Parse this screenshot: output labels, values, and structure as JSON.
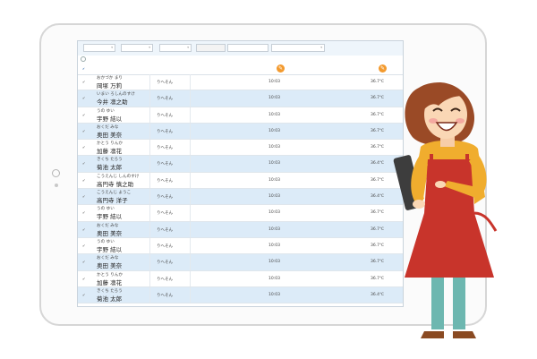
{
  "toolbar": {
    "select1": "",
    "select2": "",
    "select3": "",
    "button_label": "",
    "segment_label": "",
    "date_field": ""
  },
  "subbar": {
    "title": ""
  },
  "table": {
    "headers": {
      "name": "",
      "class": "",
      "time": "",
      "temp": ""
    },
    "rows": [
      {
        "kana": "おかづか まり",
        "kanji": "岡塚 万莉",
        "class": "りへそん",
        "time": "10:03",
        "temp": "36.7℃"
      },
      {
        "kana": "いまい ろしんのすけ",
        "kanji": "今井 凛之助",
        "class": "りへそん",
        "time": "10:03",
        "temp": "36.7℃"
      },
      {
        "kana": "うの ゆい",
        "kanji": "宇野 結以",
        "class": "りへそん",
        "time": "10:03",
        "temp": "36.7℃"
      },
      {
        "kana": "おくだ みな",
        "kanji": "奥田 美奈",
        "class": "りへそん",
        "time": "10:03",
        "temp": "36.7℃"
      },
      {
        "kana": "かとう りんか",
        "kanji": "加藤 凛花",
        "class": "りへそん",
        "time": "10:03",
        "temp": "36.7℃"
      },
      {
        "kana": "きくち たろう",
        "kanji": "菊池 太郎",
        "class": "りへそん",
        "time": "10:03",
        "temp": "36.4℃"
      },
      {
        "kana": "こうえんじ しんのすけ",
        "kanji": "高円寺 慎之助",
        "class": "りへそん",
        "time": "10:03",
        "temp": "36.7℃"
      },
      {
        "kana": "こうえんじ ようこ",
        "kanji": "高円寺 洋子",
        "class": "りへそん",
        "time": "10:03",
        "temp": "36.4℃"
      },
      {
        "kana": "うの ゆい",
        "kanji": "宇野 結以",
        "class": "りへそん",
        "time": "10:03",
        "temp": "36.7℃"
      },
      {
        "kana": "おくだ みな",
        "kanji": "奥田 美奈",
        "class": "りへそん",
        "time": "10:03",
        "temp": "36.7℃"
      },
      {
        "kana": "うの ゆい",
        "kanji": "宇野 結以",
        "class": "りへそん",
        "time": "10:03",
        "temp": "36.7℃"
      },
      {
        "kana": "おくだ みな",
        "kanji": "奥田 美奈",
        "class": "りへそん",
        "time": "10:03",
        "temp": "36.7℃"
      },
      {
        "kana": "かとう りんか",
        "kanji": "加藤 凛花",
        "class": "りへそん",
        "time": "10:03",
        "temp": "36.7℃"
      },
      {
        "kana": "きくち たろう",
        "kanji": "菊池 太郎",
        "class": "りへそん",
        "time": "10:03",
        "temp": "36.4℃"
      }
    ]
  },
  "colors": {
    "row_alt": "#dcebf8",
    "accent_orange": "#f39a2e",
    "header_blue": "#3a6fb0"
  },
  "icons": [
    "edit-pencil-icon",
    "checkbox-icon",
    "refresh-circle-icon"
  ]
}
